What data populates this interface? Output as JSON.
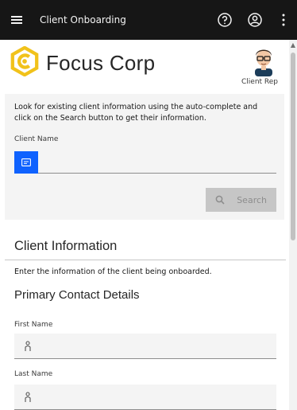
{
  "header": {
    "title": "Client Onboarding",
    "menu_icon": "hamburger-menu-icon",
    "help_icon": "help-icon",
    "user_icon": "user-avatar-icon",
    "overflow_icon": "overflow-menu-vertical-icon"
  },
  "brand": {
    "name": "Focus Corp",
    "logo_icon": "focus-corp-logo",
    "logo_color": "#f1c21b",
    "rep_label": "Client Rep"
  },
  "search": {
    "description": "Look for existing client information using the auto-complete and click on the Search button to get their information.",
    "client_name_label": "Client Name",
    "client_name_value": "",
    "button_label": "Search",
    "accent": "#0f62fe"
  },
  "client_info": {
    "title": "Client Information",
    "description": "Enter the information of the client being onboarded.",
    "primary_contact_title": "Primary Contact Details",
    "first_name_label": "First Name",
    "first_name_value": "",
    "last_name_label": "Last Name",
    "last_name_value": ""
  }
}
